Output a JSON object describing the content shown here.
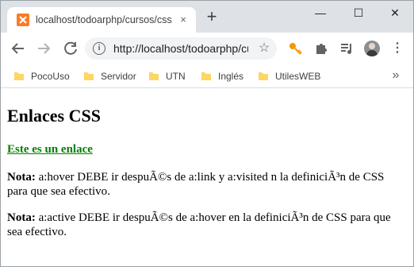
{
  "browser": {
    "tab_title": "localhost/todoarphp/cursos/css/enlaces",
    "tab_close": "×",
    "new_tab": "+",
    "window_controls": {
      "minimize": "—",
      "maximize": "☐",
      "close": "✕"
    },
    "url": "http://localhost/todoarphp/cursos/css/enlaces.php",
    "icons": [
      "back-icon",
      "forward-icon",
      "reload-icon",
      "info-icon",
      "star-icon",
      "key-icon",
      "puzzle-icon",
      "media-icon",
      "avatar",
      "menu-icon"
    ],
    "bookmarks": [
      "PocoUso",
      "Servidor",
      "UTN",
      "Inglés",
      "UtilesWEB"
    ],
    "bookmarks_more": "»",
    "colors": {
      "favicon": "#fb7a24",
      "folder": "#fdd663",
      "key": "#f29900"
    }
  },
  "page": {
    "title": "Enlaces CSS",
    "link_text": "Este es un enlace",
    "link_color": "#008000",
    "notes": [
      {
        "label": "Nota:",
        "text": " a:hover DEBE ir despuÃ©s de a:link y a:visited n la definiciÃ³n de CSS para que sea efectivo."
      },
      {
        "label": "Nota:",
        "text": " a:active DEBE ir despuÃ©s de a:hover en la definiciÃ³n de CSS para que sea efectivo."
      }
    ]
  }
}
